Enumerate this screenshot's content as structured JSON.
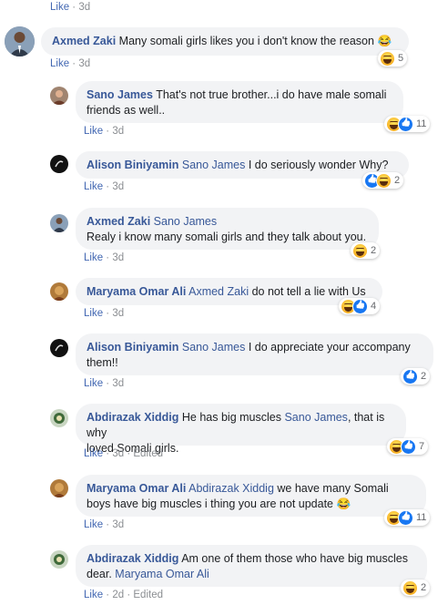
{
  "top": {
    "like": "Like",
    "time": "3d"
  },
  "comments": [
    {
      "name": "Axmed Zaki",
      "text": "Many somali girls likes you i don't know the reason",
      "like": "Like",
      "time": "3d",
      "count": "5"
    },
    {
      "name": "Sano James",
      "text1": "That's not true brother...i do have male somali",
      "text2": "friends as well..",
      "like": "Like",
      "time": "3d",
      "count": "11"
    },
    {
      "name": "Alison Biniyamin",
      "mention": "Sano James",
      "text": "I do seriously wonder Why?",
      "like": "Like",
      "time": "3d",
      "count": "2"
    },
    {
      "name": "Axmed Zaki",
      "mention": "Sano James",
      "text": "Realy i know many somali girls and they talk about you.",
      "like": "Like",
      "time": "3d",
      "count": "2"
    },
    {
      "name": "Maryama Omar Ali",
      "mention": "Axmed Zaki",
      "text": "do not tell a lie with Us",
      "like": "Like",
      "time": "3d",
      "count": "4"
    },
    {
      "name": "Alison Biniyamin",
      "mention": "Sano James",
      "text1": "I do appreciate your accompany",
      "text2": "them!!",
      "like": "Like",
      "time": "3d",
      "count": "2"
    },
    {
      "name": "Abdirazak Xiddig",
      "text1a": "He has big muscles",
      "mention": "Sano James",
      "text1b": ", that is why",
      "text2": "loved Somali girls.",
      "like": "Like",
      "time": "3d",
      "edited": "Edited",
      "count": "7"
    },
    {
      "name": "Maryama Omar Ali",
      "mention": "Abdirazak Xiddig",
      "text1": "we have many Somali",
      "text2": "boys have big muscles i thing you are not update",
      "like": "Like",
      "time": "3d",
      "count": "11"
    },
    {
      "name": "Abdirazak Xiddig",
      "text1": "Am one of them those who have big muscles",
      "text2": "dear.",
      "mention": "Maryama Omar Ali",
      "like": "Like",
      "time": "2d",
      "edited": "Edited",
      "count": "2"
    }
  ],
  "icons": {
    "haha": "haha-reaction-icon",
    "like": "like-reaction-icon"
  }
}
